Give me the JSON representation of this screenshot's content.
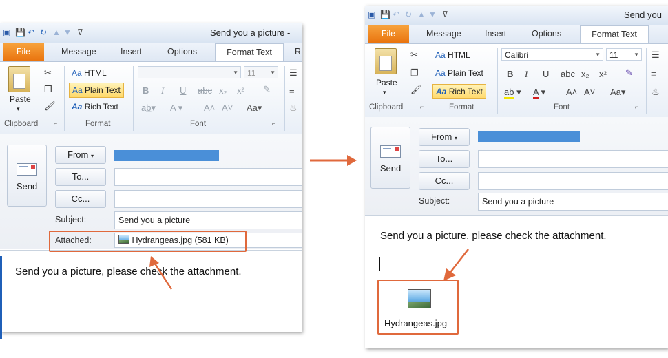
{
  "window_title": "Send you a picture -",
  "window_title_right": "Send you",
  "tabs": {
    "file": "File",
    "message": "Message",
    "insert": "Insert",
    "options": "Options",
    "format_text": "Format Text",
    "overflow": "R"
  },
  "ribbon": {
    "paste": "Paste",
    "clipboard_group": "Clipboard",
    "html": "HTML",
    "plain_text": "Plain Text",
    "rich_text": "Rich Text",
    "format_group": "Format",
    "font_group": "Font",
    "font_name": "Calibri",
    "font_size": "11",
    "font_size_disabled": "11",
    "aa_prefix": "Aa",
    "bold": "B",
    "italic": "I",
    "underline": "U",
    "strike": "abc",
    "subscript": "x₂",
    "superscript": "x²",
    "grow_font": "A˄",
    "shrink_font": "A˅",
    "change_case": "Aa",
    "font_color": "A"
  },
  "compose": {
    "send": "Send",
    "from": "From",
    "to": "To...",
    "cc": "Cc...",
    "subject_label": "Subject:",
    "subject_value": "Send you a picture",
    "attached_label": "Attached:",
    "attachment": "Hydrangeas.jpg (581 KB)",
    "body": "Send you a picture, please check the attachment.",
    "inline_image_name": "Hydrangeas.jpg"
  },
  "colors": {
    "highlight_border": "#e0693c",
    "arrow": "#e0693c",
    "file_tab": "#e9740f",
    "from_bar": "#4a8fd8"
  },
  "icons": [
    "save-icon",
    "undo-icon",
    "redo-icon",
    "paste-icon",
    "cut-icon",
    "copy-icon",
    "format-painter-icon",
    "send-envelope-icon",
    "image-file-icon",
    "arrow-right-icon",
    "arrow-pointer-icon"
  ]
}
